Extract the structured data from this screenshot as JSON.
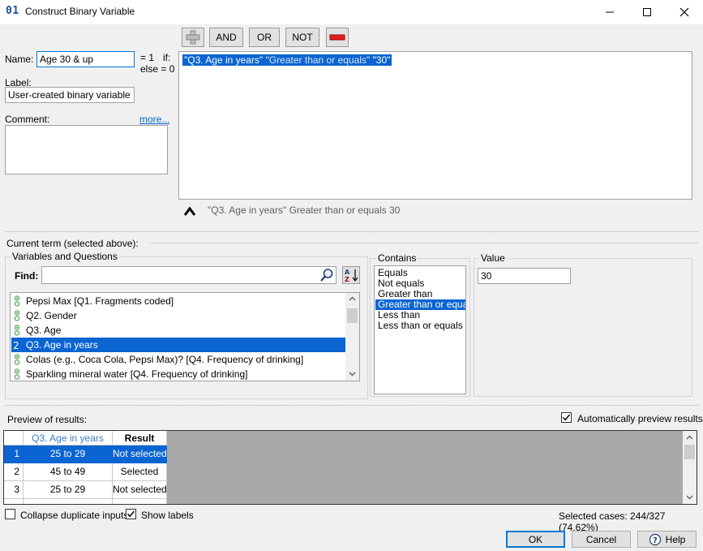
{
  "window": {
    "app_code": "01",
    "title": "Construct Binary Variable",
    "minimize_icon": "minimize-icon",
    "maximize_icon": "maximize-icon",
    "close_icon": "close-icon"
  },
  "toolbar": {
    "add_icon": "plus-icon",
    "and_label": "AND",
    "or_label": "OR",
    "not_label": "NOT",
    "remove_icon": "minus-icon"
  },
  "form": {
    "name_label": "Name:",
    "name_value": "Age 30 & up",
    "eq1_text": "= 1",
    "if_text": "if:",
    "else_text": "else = 0",
    "label_label": "Label:",
    "label_value": "User-created binary variable",
    "comment_label": "Comment:",
    "more_link": "more...",
    "comment_value": ""
  },
  "expression": {
    "var_part": "\"Q3. Age in years\"",
    "op_part": "\"Greater than or equals\"",
    "val_part": "\"30\"",
    "caret_icon": "caret-up-icon",
    "summary": "\"Q3. Age in years\" Greater than or equals 30"
  },
  "current_term": {
    "label": "Current term (selected above):"
  },
  "variables": {
    "group_title": "Variables and Questions",
    "find_label": "Find:",
    "find_value": "",
    "search_icon": "magnifier-icon",
    "sort_icon": "sort-az-icon",
    "items": [
      {
        "label": "Pepsi Max [Q1.  Fragments coded]",
        "icon": "nominal-icon"
      },
      {
        "label": "Q2. Gender",
        "icon": "nominal-icon"
      },
      {
        "label": "Q3. Age",
        "icon": "nominal-icon"
      },
      {
        "label": "Q3. Age in years",
        "icon": "numeric-icon"
      },
      {
        "label": "Colas (e.g., Coca Cola, Pepsi Max)? [Q4. Frequency of drinking]",
        "icon": "nominal-icon"
      },
      {
        "label": "Sparkling mineral water [Q4. Frequency of drinking]",
        "icon": "nominal-icon"
      }
    ],
    "selected_index": 3
  },
  "contains": {
    "group_title": "Contains",
    "options": [
      "Equals",
      "Not equals",
      "Greater than",
      "Greater than or equals",
      "Less than",
      "Less than or equals"
    ],
    "selected_index": 3
  },
  "value": {
    "group_title": "Value",
    "value": "30"
  },
  "preview": {
    "label": "Preview of results:",
    "auto_preview_label": "Automatically preview results",
    "auto_preview_checked": true,
    "columns": [
      "Q3. Age in years",
      "Result"
    ],
    "rows": [
      {
        "num": "1",
        "age": "25 to 29",
        "result": "Not selected"
      },
      {
        "num": "2",
        "age": "45 to 49",
        "result": "Selected"
      },
      {
        "num": "3",
        "age": "25 to 29",
        "result": "Not selected"
      }
    ],
    "collapse_label": "Collapse duplicate inputs",
    "collapse_checked": false,
    "show_labels_label": "Show labels",
    "show_labels_checked": true,
    "selected_cases": "Selected cases: 244/327 (74.62%)"
  },
  "buttons": {
    "ok": "OK",
    "cancel": "Cancel",
    "help": "Help",
    "help_icon": "help-question-icon"
  }
}
